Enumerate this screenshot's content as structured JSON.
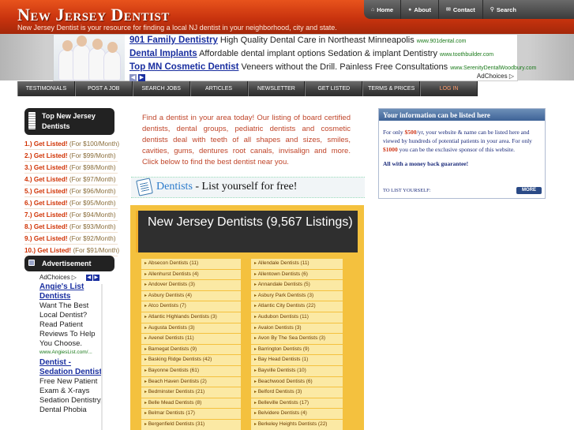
{
  "site": {
    "title": "New Jersey Dentist",
    "tagline": "New Jersey Dentist is your resource for finding a local NJ dentist in your neighborhood, city and state."
  },
  "top_nav": [
    {
      "label": "Home",
      "icon": "house-icon"
    },
    {
      "label": "About",
      "icon": "info-icon"
    },
    {
      "label": "Contact",
      "icon": "envelope-icon"
    },
    {
      "label": "Search",
      "icon": "search-icon"
    }
  ],
  "banner_ads": [
    {
      "title": "901 Family Dentistry",
      "text": "High Quality Dental Care in Northeast Minneapolis",
      "url": "www.901dental.com"
    },
    {
      "title": "Dental Implants",
      "text": "Affordable dental implant options Sedation & implant Dentistry",
      "url": "www.toothbuilder.com"
    },
    {
      "title": "Top MN Cosmetic Dentist",
      "text": "Veneers without the Drill. Painless Free Consultations",
      "url": "www.SerenityDentalWoodbury.com"
    }
  ],
  "adchoices": "AdChoices",
  "main_nav": [
    "TESTIMONIALS",
    "POST A JOB",
    "SEARCH JOBS",
    "ARTICLES",
    "NEWSLETTER",
    "GET LISTED",
    "TERMS & PRICES",
    "LOG IN"
  ],
  "sidebar": {
    "top_header": "Top New Jersey Dentists",
    "offers": [
      {
        "rank": "1.) Get Listed!",
        "price": "(For $100/Month)"
      },
      {
        "rank": "2.) Get Listed!",
        "price": "(For $99/Month)"
      },
      {
        "rank": "3.) Get Listed!",
        "price": "(For $98/Month)"
      },
      {
        "rank": "4.) Get Listed!",
        "price": "(For $97/Month)"
      },
      {
        "rank": "5.) Get Listed!",
        "price": "(For $96/Month)"
      },
      {
        "rank": "6.) Get Listed!",
        "price": "(For $95/Month)"
      },
      {
        "rank": "7.) Get Listed!",
        "price": "(For $94/Month)"
      },
      {
        "rank": "8.) Get Listed!",
        "price": "(For $93/Month)"
      },
      {
        "rank": "9.) Get Listed!",
        "price": "(For $92/Month)"
      },
      {
        "rank": "10.) Get Listed!",
        "price": "(For $91/Month)"
      }
    ],
    "advertisement_header": "Advertisement",
    "ads": [
      {
        "title": "Angie's List Dentists",
        "text": "Want The Best Local Dentist? Read Patient Reviews To Help You Choose.",
        "url": "www.AngiesList.com/..."
      },
      {
        "title": "Dentist -Sedation Dentist",
        "text": "Free New Patient Exam & X-rays Sedation Dentistry, Dental Phobia",
        "url": ""
      }
    ]
  },
  "intro": "Find a dentist in your area today! Our listing of board certified dentists, dental groups, pediatric dentists and cosmetic dentists deal with teeth of all shapes and sizes, smiles, cavities, gums, dentures root canals, invisalign and more. Click below to find the best dentist near you.",
  "list_free": {
    "keyword": "Dentists",
    "text": "- List yourself for free!"
  },
  "listings": {
    "title": "New Jersey Dentists (9,567 Listings)",
    "left": [
      "Absecon Dentists (11)",
      "Allenhurst Dentists (4)",
      "Andover Dentists (3)",
      "Asbury Dentists (4)",
      "Atco Dentists (7)",
      "Atlantic Highlands Dentists (3)",
      "Augusta Dentists (3)",
      "Avenel Dentists (11)",
      "Barnegat Dentists (9)",
      "Basking Ridge Dentists (42)",
      "Bayonne Dentists (61)",
      "Beach Haven Dentists (2)",
      "Bedminster Dentists (21)",
      "Belle Mead Dentists (8)",
      "Belmar Dentists (17)",
      "Bergenfield Dentists (31)"
    ],
    "right": [
      "Allendale Dentists (11)",
      "Allentown Dentists (6)",
      "Annandale Dentists (5)",
      "Asbury Park Dentists (3)",
      "Atlantic City Dentists (22)",
      "Audubon Dentists (11)",
      "Avalon Dentists (3)",
      "Avon By The Sea Dentists (3)",
      "Barrington Dentists (9)",
      "Bay Head Dentists (1)",
      "Bayville Dentists (10)",
      "Beachwood Dentists (6)",
      "Belford Dentists (3)",
      "Belleville Dentists (17)",
      "Belvidere Dentists (4)",
      "Berkeley Heights Dentists (22)"
    ]
  },
  "info_box": {
    "title": "Your information can be listed here",
    "body_1": "For only ",
    "price": "$500",
    "body_2": "/yr, your website & name can be listed here and viewed by hundreds of potential patients in your area. For only ",
    "price_2": "$1000",
    "body_3": " you can be the exclusive sponsor of this website.",
    "guarantee": "All with a money back guarantee!",
    "list_yourself": "TO LIST YOURSELF:",
    "more": "MORE"
  }
}
